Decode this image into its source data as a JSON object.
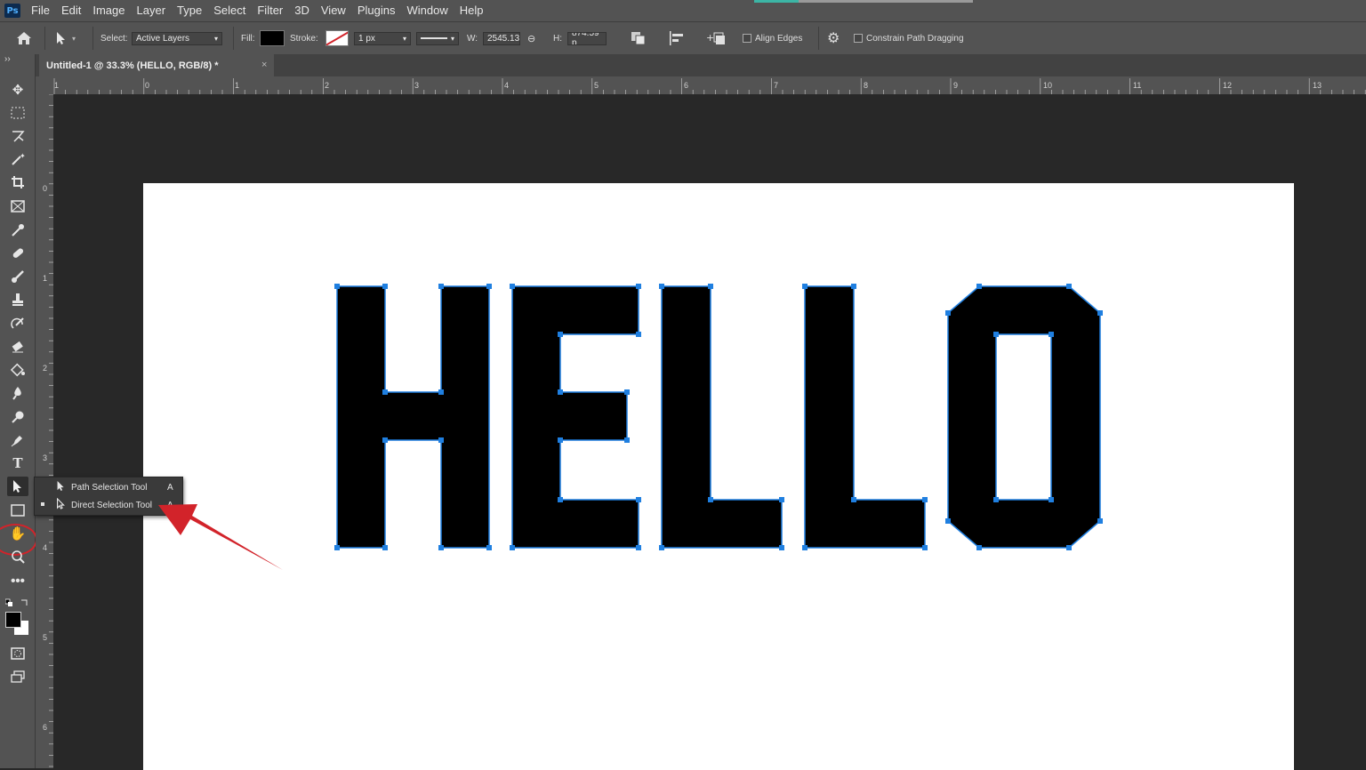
{
  "app": {
    "logo_text": "Ps"
  },
  "menu": [
    "File",
    "Edit",
    "Image",
    "Layer",
    "Type",
    "Select",
    "Filter",
    "3D",
    "View",
    "Plugins",
    "Window",
    "Help"
  ],
  "options": {
    "select_label": "Select:",
    "select_value": "Active Layers",
    "fill_label": "Fill:",
    "stroke_label": "Stroke:",
    "stroke_width": "1 px",
    "w_label": "W:",
    "w_value": "2545.13",
    "h_label": "H:",
    "h_value": "874.59 p",
    "align_edges": "Align Edges",
    "constrain": "Constrain Path Dragging"
  },
  "document_tab": {
    "title": "Untitled-1 @ 33.3% (HELLO, RGB/8) *",
    "close": "×"
  },
  "ruler": {
    "top_ticks": [
      "1",
      "0",
      "1",
      "2",
      "3",
      "4",
      "5",
      "6",
      "7",
      "8",
      "9",
      "10",
      "11",
      "12",
      "13"
    ],
    "left_ticks": [
      "0",
      "1",
      "2",
      "3",
      "4",
      "5",
      "6"
    ]
  },
  "canvas_text": "HELLO",
  "flyout": [
    {
      "label": "Path Selection Tool",
      "shortcut": "A",
      "selected": false
    },
    {
      "label": "Direct Selection Tool",
      "shortcut": "A",
      "selected": true
    }
  ],
  "colors": {
    "path_anchor": "#1f7fe0",
    "arrow": "#d2232a",
    "foreground": "#000000",
    "background": "#ffffff"
  },
  "tools": [
    "move-tool-icon",
    "marquee-tool-icon",
    "lasso-tool-icon",
    "magic-wand-icon",
    "crop-tool-icon",
    "frame-tool-icon",
    "eyedropper-icon",
    "healing-brush-icon",
    "brush-icon",
    "clone-stamp-icon",
    "history-brush-icon",
    "eraser-icon",
    "paint-bucket-icon",
    "blur-tool-icon",
    "dodge-tool-icon",
    "pen-tool-icon",
    "type-tool-icon",
    "path-selection-icon",
    "rectangle-tool-icon",
    "hand-tool-icon",
    "zoom-tool-icon",
    "more-tools-icon"
  ]
}
